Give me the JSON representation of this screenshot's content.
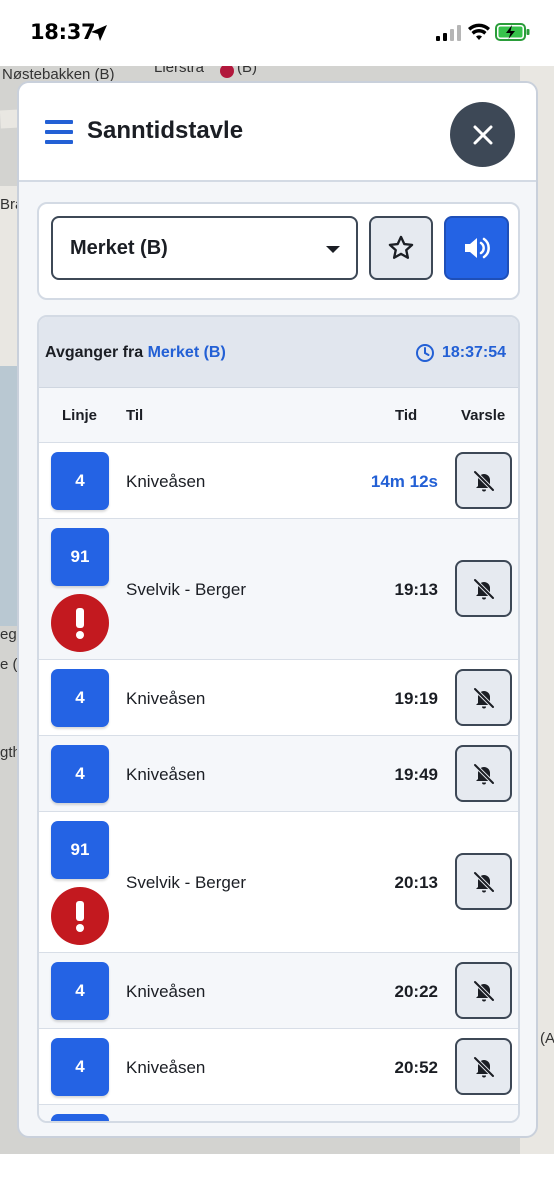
{
  "status_bar": {
    "time": "18:37"
  },
  "map": {
    "labels": [
      "Nøstebakken (B)",
      "Lierstra",
      "(B)",
      "Bra",
      "eg",
      "e (",
      "gth",
      "(A"
    ]
  },
  "panel": {
    "title": "Sanntidstavle",
    "menu_icon": "hamburger-icon",
    "close_icon": "close-icon"
  },
  "controls": {
    "selected_stop": "Merket (B)",
    "favorite_icon": "star-icon",
    "sound_icon": "speaker-icon"
  },
  "board": {
    "label_prefix": "Avganger fra",
    "stop_name": "Merket (B)",
    "clock": "18:37:54",
    "columns": {
      "linje": "Linje",
      "til": "Til",
      "tid": "Tid",
      "varsle": "Varsle"
    },
    "departures": [
      {
        "line": "4",
        "destination": "Kniveåsen",
        "time": "14m 12s",
        "relative": true,
        "alert": false
      },
      {
        "line": "91",
        "destination": "Svelvik - Berger",
        "time": "19:13",
        "relative": false,
        "alert": true
      },
      {
        "line": "4",
        "destination": "Kniveåsen",
        "time": "19:19",
        "relative": false,
        "alert": false
      },
      {
        "line": "4",
        "destination": "Kniveåsen",
        "time": "19:49",
        "relative": false,
        "alert": false
      },
      {
        "line": "91",
        "destination": "Svelvik - Berger",
        "time": "20:13",
        "relative": false,
        "alert": true
      },
      {
        "line": "4",
        "destination": "Kniveåsen",
        "time": "20:22",
        "relative": false,
        "alert": false
      },
      {
        "line": "4",
        "destination": "Kniveåsen",
        "time": "20:52",
        "relative": false,
        "alert": false
      }
    ]
  },
  "colors": {
    "accent": "#2463e4",
    "alert": "#c3191f",
    "dark": "#3d4856"
  }
}
